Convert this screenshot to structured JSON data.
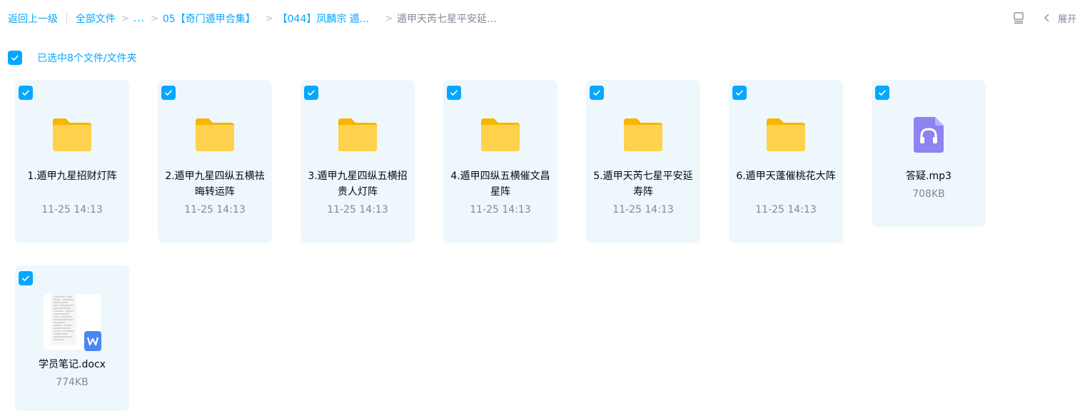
{
  "breadcrumb": {
    "back": "返回上一级",
    "all_files": "全部文件",
    "ellipsis": "...",
    "level1": "05【奇门遁甲合集】",
    "level2": "【044】凤麟宗 遁...",
    "current": "遁甲天芮七星平安延..."
  },
  "toolbar": {
    "view_icon": "list-view-icon",
    "expand_icon": "chevron-left-icon",
    "expand_label": "展开"
  },
  "selection": {
    "text": "已选中8个文件/文件夹",
    "checked": true
  },
  "colors": {
    "accent": "#06a7ff",
    "card_bg": "#eef7fc",
    "folder": "#ffc531",
    "audio": "#8e83ef",
    "word": "#4a86f4"
  },
  "files": [
    {
      "type": "folder",
      "name": "1.遁甲九星招财灯阵",
      "meta": "11-25 14:13"
    },
    {
      "type": "folder",
      "name": "2.遁甲九星四纵五横祛晦转运阵",
      "meta": "11-25 14:13"
    },
    {
      "type": "folder",
      "name": "3.遁甲九星四纵五横招贵人灯阵",
      "meta": "11-25 14:13"
    },
    {
      "type": "folder",
      "name": "4.遁甲四纵五横催文昌星阵",
      "meta": "11-25 14:13"
    },
    {
      "type": "folder",
      "name": "5.遁甲天芮七星平安延寿阵",
      "meta": "11-25 14:13"
    },
    {
      "type": "folder",
      "name": "6.遁甲天蓬催桃花大阵",
      "meta": "11-25 14:13"
    },
    {
      "type": "audio",
      "name": "答疑.mp3",
      "meta": "708KB"
    },
    {
      "type": "doc",
      "name": "学员笔记.docx",
      "meta": "774KB"
    }
  ]
}
